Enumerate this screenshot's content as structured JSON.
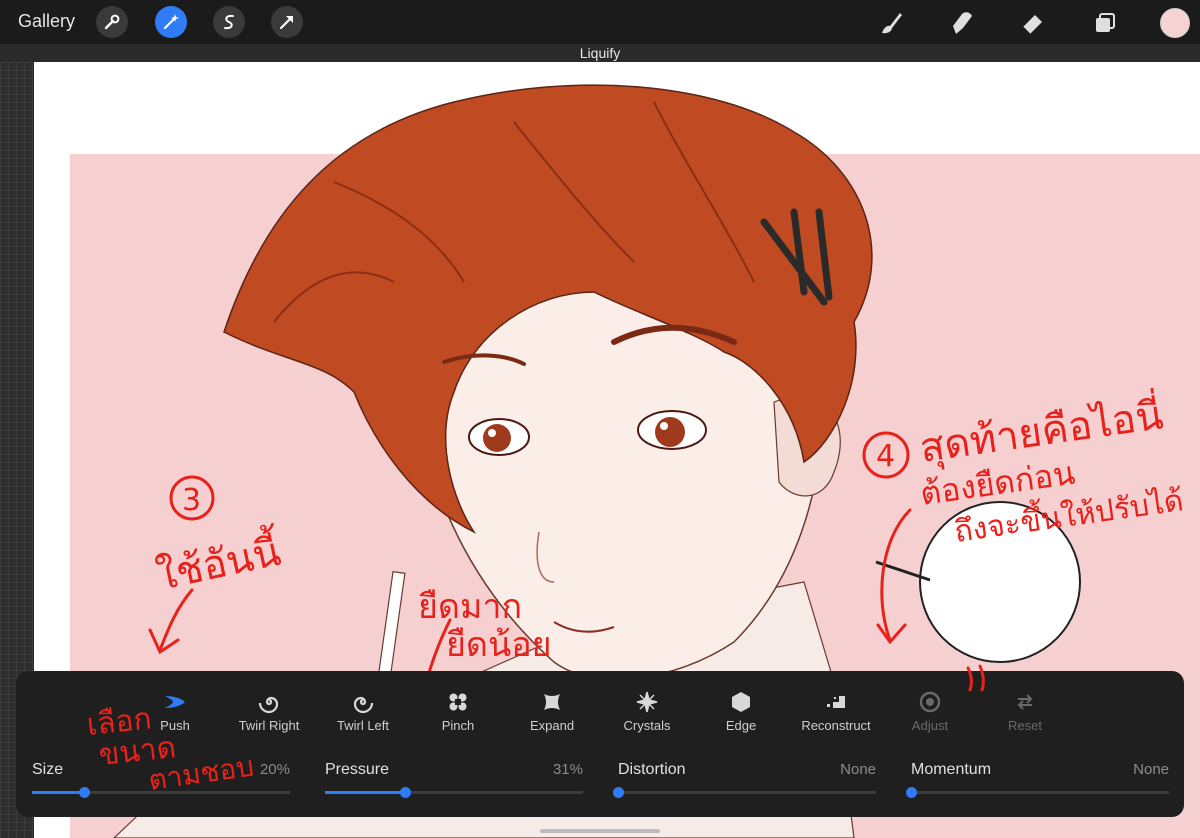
{
  "topbar": {
    "gallery_label": "Gallery",
    "left_tools": [
      "wrench-icon",
      "magic-wand-icon",
      "selection-icon",
      "transform-arrow-icon"
    ],
    "right_tools": [
      "brush-icon",
      "smudge-icon",
      "eraser-icon",
      "layers-icon"
    ],
    "current_color": "#f4d3d1",
    "accent": "#2f7cf6"
  },
  "subbar": {
    "title": "Liquify"
  },
  "panel": {
    "modes": [
      {
        "label": "Push",
        "icon": "push-icon"
      },
      {
        "label": "Twirl Right",
        "icon": "twirl-right-icon"
      },
      {
        "label": "Twirl Left",
        "icon": "twirl-left-icon"
      },
      {
        "label": "Pinch",
        "icon": "pinch-icon"
      },
      {
        "label": "Expand",
        "icon": "expand-icon"
      },
      {
        "label": "Crystals",
        "icon": "crystals-icon"
      },
      {
        "label": "Edge",
        "icon": "edge-icon"
      },
      {
        "label": "Reconstruct",
        "icon": "reconstruct-icon"
      },
      {
        "label": "Adjust",
        "icon": "adjust-icon"
      },
      {
        "label": "Reset",
        "icon": "reset-icon"
      }
    ],
    "sliders": [
      {
        "name": "Size",
        "value": "20%",
        "level": 0.2
      },
      {
        "name": "Pressure",
        "value": "31%",
        "level": 0.31
      },
      {
        "name": "Distortion",
        "value": "None",
        "level": 0
      },
      {
        "name": "Momentum",
        "value": "None",
        "level": 0
      }
    ]
  },
  "annotations": {
    "step3_number": "3",
    "step3_note": "ใช้อันนี้",
    "step4_number": "4",
    "step4_note_line1": "สุดท้ายคือไอนี่",
    "step4_note_line2": "ต้องยืดก่อน",
    "step4_note_line3": "ถึงจะขึ้นให้ปรับได้",
    "pressure_note_line1": "ยืดมาก",
    "pressure_note_line2": "ยืดน้อย",
    "size_note_line1": "เลือก",
    "size_note_line2": "ขนาด",
    "size_note_line3": "ตามชอบ",
    "annotation_color": "#e8221b"
  }
}
